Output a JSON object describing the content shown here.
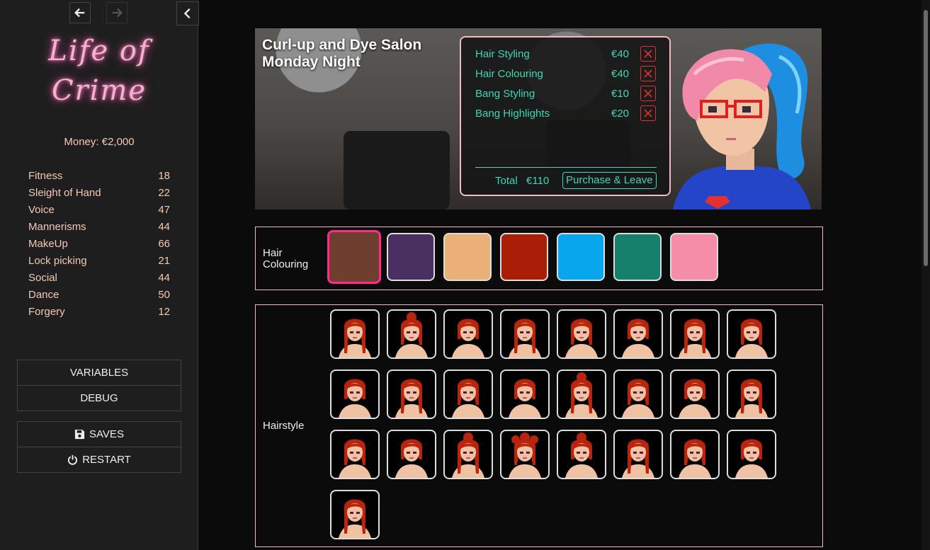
{
  "nav": {
    "back_icon": "arrow-left-icon",
    "forward_icon": "arrow-right-icon",
    "collapse_icon": "chevron-left-icon"
  },
  "sidebar": {
    "logo": "Life of Crime",
    "money": "Money: €2,000",
    "stats": [
      {
        "label": "Fitness",
        "value": "18"
      },
      {
        "label": "Sleight of Hand",
        "value": "22"
      },
      {
        "label": "Voice",
        "value": "47"
      },
      {
        "label": "Mannerisms",
        "value": "44"
      },
      {
        "label": "MakeUp",
        "value": "66"
      },
      {
        "label": "Lock picking",
        "value": "21"
      },
      {
        "label": "Social",
        "value": "44"
      },
      {
        "label": "Dance",
        "value": "50"
      },
      {
        "label": "Forgery",
        "value": "12"
      }
    ],
    "menu": {
      "variables": "VARIABLES",
      "debug": "DEBUG",
      "saves": "SAVES",
      "restart": "RESTART"
    }
  },
  "banner": {
    "title_line1": "Curl-up and Dye Salon",
    "title_line2": "Monday Night"
  },
  "receipt": {
    "items": [
      {
        "name": "Hair Styling",
        "price": "€40"
      },
      {
        "name": "Hair Colouring",
        "price": "€40"
      },
      {
        "name": "Bang Styling",
        "price": "€10"
      },
      {
        "name": "Bang Highlights",
        "price": "€20"
      }
    ],
    "total_label": "Total",
    "total_value": "€110",
    "purchase": "Purchase & Leave"
  },
  "colouring": {
    "label_line1": "Hair",
    "label_line2": "Colouring",
    "swatches": [
      "#6e3f2e",
      "#4a3060",
      "#eab077",
      "#aa1e08",
      "#08a6ec",
      "#16806a",
      "#f58ca8"
    ],
    "selected_index": 0,
    "selected_color": "#ff2a8a"
  },
  "hairstyle": {
    "label": "Hairstyle",
    "count": 25
  },
  "colors": {
    "accent_teal": "#3fd6b6",
    "accent_pink": "#f5b8c8"
  }
}
